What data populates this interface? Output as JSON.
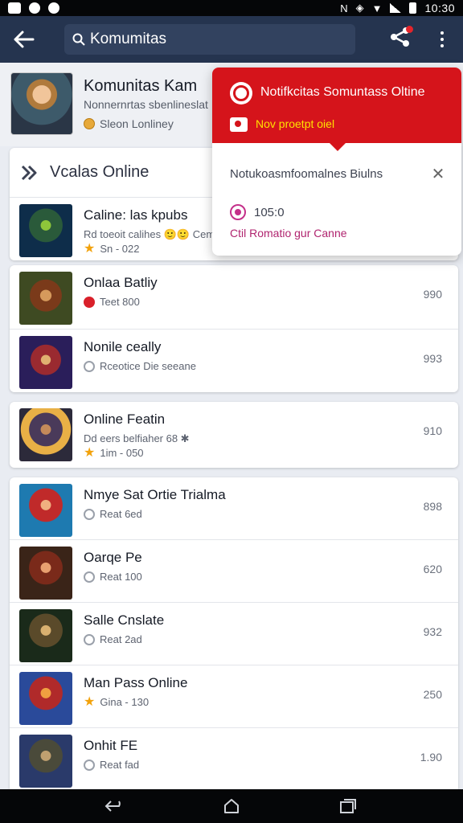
{
  "status_bar": {
    "time": "10:30",
    "left_icons": [
      "notification-icon",
      "app-icon",
      "dot-icon"
    ],
    "right_icons": [
      "nfc-icon",
      "alarm-icon",
      "wifi-icon",
      "signal-icon",
      "battery-icon"
    ]
  },
  "header": {
    "search_value": "Komumitas",
    "back_icon": "back-arrow-icon",
    "share_icon": "share-icon",
    "more_icon": "more-vertical-icon"
  },
  "community": {
    "title": "Komunitas Kam",
    "subtitle": "Nonnernrtas sbenlineslat",
    "status": "Sleon Lonliney"
  },
  "section": {
    "title": "Vcalas Online",
    "icon": "arrow-share-icon"
  },
  "colors": {
    "header_bg": "#25344f",
    "notif_red": "#d5141b",
    "notif_accent": "#ffe000",
    "link_magenta": "#b0246f"
  },
  "notification": {
    "title": "Notifkcitas Somuntass Oltine",
    "highlight": "Nov proetpt oiel",
    "message": "Notukoasmfoomalnes Biulns",
    "count": "105:0",
    "link": "Ctil Romatio gur Canne"
  },
  "groups": [
    {
      "items": [
        {
          "title": "Caline: las kpubs",
          "sub": "Rd toeoit calihes 🙂🙂 Cema",
          "sub2": "Sn - 022",
          "badge": "star",
          "value": ""
        }
      ]
    },
    {
      "items": [
        {
          "title": "Onlaa Batliy",
          "sub": "Teet 800",
          "badge": "red",
          "value": "990"
        },
        {
          "title": "Nonile ceally",
          "sub": "Rceotice Die seeane",
          "badge": "gray",
          "value": "993"
        }
      ]
    },
    {
      "items": [
        {
          "title": "Online Featin",
          "sub": "Dd eers belfiaher 68 ✱",
          "sub2": "1im - 050",
          "badge": "star",
          "value": "910"
        }
      ]
    },
    {
      "items": [
        {
          "title": "Nmye Sat Ortie Trialma",
          "sub": "Reat 6ed",
          "badge": "gray",
          "value": "898"
        },
        {
          "title": "Oarqe Pe",
          "sub": "Reat 100",
          "badge": "gray",
          "value": "620"
        },
        {
          "title": "Salle Cnslate",
          "sub": "Reat 2ad",
          "badge": "gray",
          "value": "932"
        },
        {
          "title": "Man Pass Online",
          "sub": "Gina - 130",
          "badge": "star",
          "value": "250"
        },
        {
          "title": "Onhit FE",
          "sub": "Reat fad",
          "badge": "gray",
          "value": "1.90"
        }
      ]
    }
  ]
}
